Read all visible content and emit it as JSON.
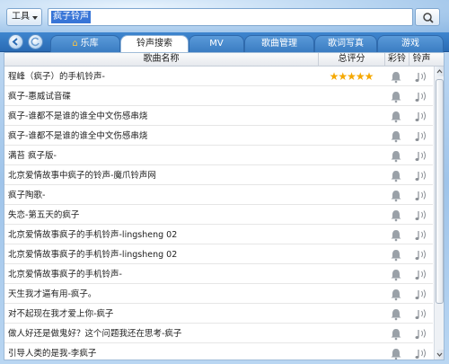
{
  "toolbar": {
    "tools_label": "工具",
    "search_value": "疯子铃声"
  },
  "tabs": [
    {
      "label": "乐库",
      "active": false
    },
    {
      "label": "铃声搜索",
      "active": true
    },
    {
      "label": "MV",
      "active": false
    },
    {
      "label": "歌曲管理",
      "active": false
    },
    {
      "label": "歌词写真",
      "active": false
    },
    {
      "label": "游戏",
      "active": false
    }
  ],
  "table": {
    "headers": {
      "name": "歌曲名称",
      "rating": "总评分",
      "color_ring": "彩铃",
      "ringtone": "铃声"
    },
    "rows": [
      {
        "name": "程峰（疯子）的手机铃声-",
        "rating": "★★★★★"
      },
      {
        "name": "疯子-惠威试音碟",
        "rating": ""
      },
      {
        "name": "疯子-谁都不是谁的谁全中文伤感串烧",
        "rating": ""
      },
      {
        "name": "疯子-谁都不是谁的谁全中文伤感串烧",
        "rating": ""
      },
      {
        "name": "满苔 疯子版-",
        "rating": ""
      },
      {
        "name": "北京爱情故事中疯子的铃声-魔爪铃声网",
        "rating": ""
      },
      {
        "name": "疯子陶歌-",
        "rating": ""
      },
      {
        "name": "失恋-第五天的疯子",
        "rating": ""
      },
      {
        "name": "北京爱情故事疯子的手机铃声-lingsheng 02",
        "rating": ""
      },
      {
        "name": "北京爱情故事疯子的手机铃声-lingsheng 02",
        "rating": ""
      },
      {
        "name": "北京爱情故事疯子的手机铃声-",
        "rating": ""
      },
      {
        "name": "天生我才逼有用-疯子。",
        "rating": ""
      },
      {
        "name": "对不起现在我才爱上你-疯子",
        "rating": ""
      },
      {
        "name": "做人好还是做鬼好？这个问题我还在思考-疯子",
        "rating": ""
      },
      {
        "name": "引导人类的是我-李疯子",
        "rating": ""
      }
    ]
  },
  "colors": {
    "accent": "#2a6bb4",
    "star": "#f5a800"
  }
}
